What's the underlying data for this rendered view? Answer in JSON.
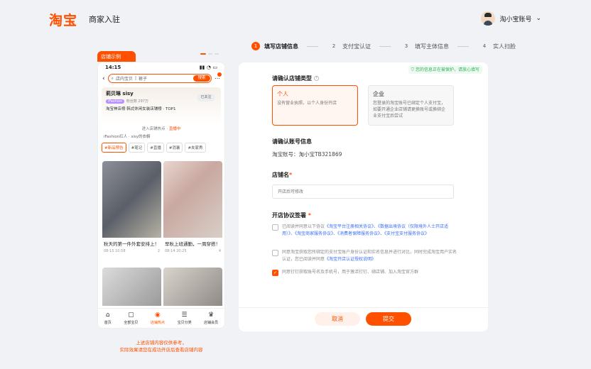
{
  "header": {
    "logo": "淘宝",
    "title": "商家入驻",
    "account": "淘小宝账号"
  },
  "steps": [
    {
      "num": "1",
      "label": "填写店铺信息",
      "active": true
    },
    {
      "num": "2",
      "label": "支付宝认证"
    },
    {
      "num": "3",
      "label": "填写主体信息"
    },
    {
      "num": "4",
      "label": "实人扫脸"
    }
  ],
  "sample": {
    "tag": "店铺示例",
    "time": "14:15",
    "search_text": "店内宝贝",
    "search_query": "裤子",
    "search_btn": "搜索",
    "shop_name": "莉贝琳 sisy",
    "shop_badge": "iFashion",
    "fans": "粉丝数 297万",
    "rank": "淘宝神店榜 韩式休闲女装店铺榜 · TOP1",
    "follow": "已关注",
    "live_prefix": "进入店铺热点 · ",
    "live": "直播中",
    "ifs": "iFashion红人 · sisy的衣橱",
    "tabs": [
      "#新品预告",
      "#笔记",
      "#直播",
      "#消暑",
      "#夹家秀"
    ],
    "cards": [
      {
        "title": "秋天的第一件外套安排上！",
        "date": "08-15 10:58",
        "likes": "2"
      },
      {
        "title": "早秋上班通勤，一周穿搭！",
        "date": "08-14 20:25",
        "likes": "4"
      }
    ],
    "nav": [
      {
        "icon": "⌂",
        "label": "首页"
      },
      {
        "icon": "▢",
        "label": "全部宝贝"
      },
      {
        "icon": "◉",
        "label": "店铺热点",
        "on": true
      },
      {
        "icon": "☰",
        "label": "宝贝分类"
      },
      {
        "icon": "♛",
        "label": "店铺会员"
      }
    ],
    "note1": "上述店铺内容仅供参考，",
    "note2": "实际效果请您在成功开店后查看店铺内容"
  },
  "form": {
    "tip": "您的信息正在被保护，请放心填写",
    "type_label": "请确认店铺类型",
    "opt_personal_t": "个人",
    "opt_personal_d": "没有营业执照，以个人身份开店",
    "opt_company_t": "企业",
    "opt_company_d": "您登录的淘宝账号已绑定个人支付宝，如要开通企业店铺请更换账号或换绑企业支付宝后尝试",
    "account_label": "请确认账号信息",
    "account_value": "淘宝账号：淘小宝TB321869",
    "name_label": "店铺名",
    "name_placeholder": "开店后可修改",
    "agree_label": "开店协议签署",
    "agree1_text": "已阅读并同意以下协议",
    "agree1_links": "《淘宝平台注册相关协议》、《数据出境协议（仅限境外人士开店适用）》、《淘宝商家服务协议》、《消费者保障服务协议》、《支付宝支付服务协议》",
    "agree2_text": "同意淘宝获取您所绑定的支付宝账户身份认证和实名信息并进行对比，同时完成淘宝用户实名认证，您已阅读并同意",
    "agree2_link": "《淘宝开店认证授权说明》",
    "agree3_text": "同意钉钉获取账号名及手机号，用于激活钉钉、绑店铺、加入淘宝官方群",
    "cancel": "取消",
    "submit": "提交"
  }
}
